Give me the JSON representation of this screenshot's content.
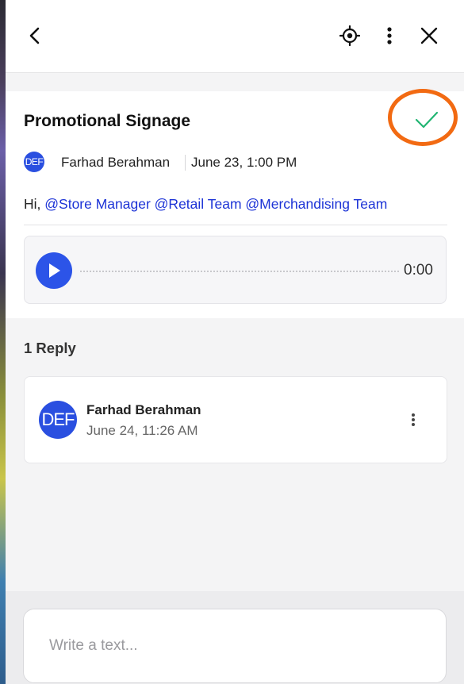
{
  "header": {
    "back_icon": "chevron-left-icon",
    "locate_icon": "crosshair-icon",
    "more_icon": "vertical-dots-icon",
    "close_icon": "close-icon"
  },
  "post": {
    "title": "Promotional Signage",
    "resolve_icon": "checkmark-icon",
    "resolve_color": "#22b573",
    "highlight_color": "#f26a12",
    "avatar_initials": "DEF",
    "author": "Farhad Berahman",
    "date": "June 23, 1:00 PM",
    "message_prefix": "Hi,",
    "mentions": [
      "@Store Manager",
      "@Retail Team",
      "@Merchandising Team"
    ],
    "audio": {
      "play_icon": "play-icon",
      "time": "0:00"
    }
  },
  "replies": {
    "count_label": "1 Reply",
    "items": [
      {
        "avatar_initials": "DEF",
        "author": "Farhad Berahman",
        "date": "June 24, 11:26 AM",
        "more_icon": "vertical-dots-icon"
      }
    ]
  },
  "composer": {
    "placeholder": "Write a text...",
    "value": ""
  },
  "colors": {
    "accent": "#2c54e8",
    "mention": "#1c33d6"
  }
}
